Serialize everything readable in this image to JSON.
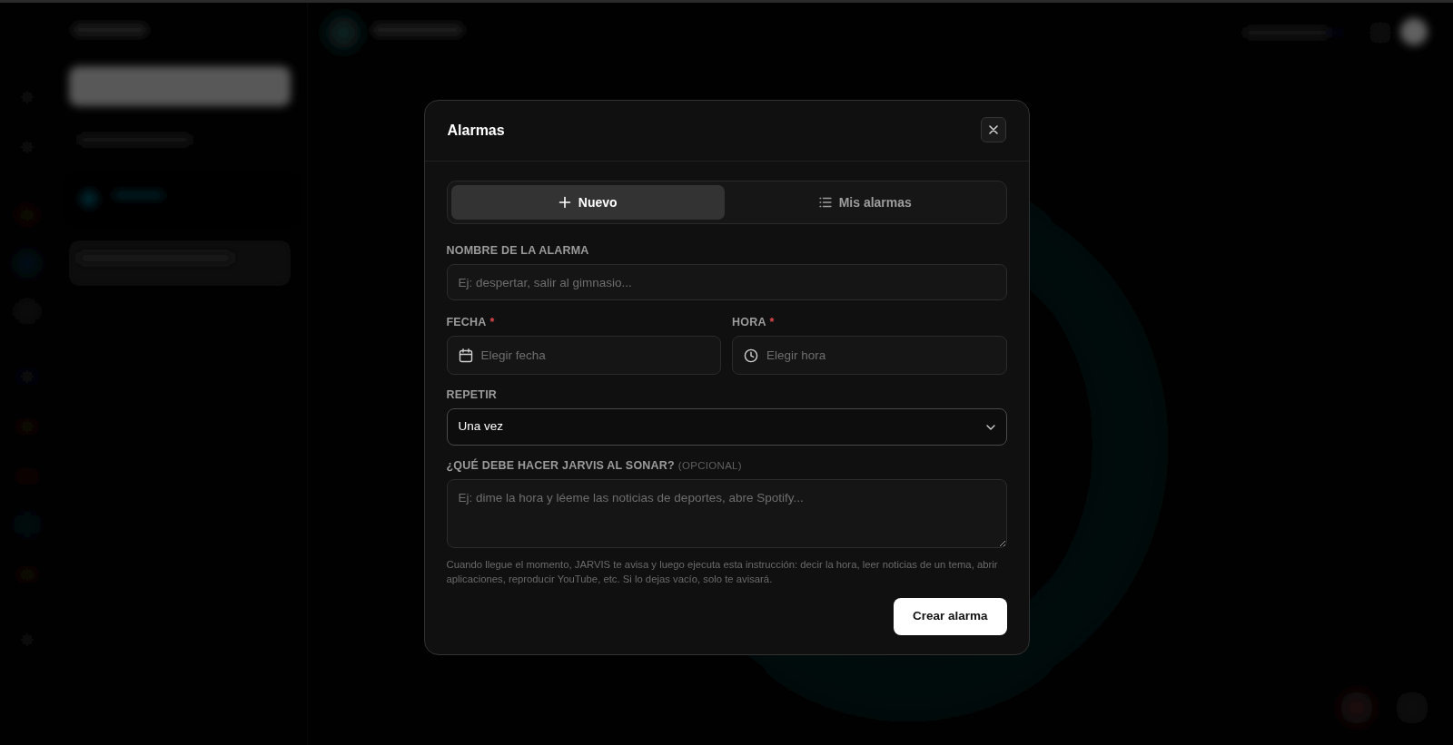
{
  "dialog": {
    "title": "Alarmas",
    "tabs": [
      {
        "kind": "new",
        "label": "Nuevo",
        "selected": true
      },
      {
        "kind": "list",
        "label": "Mis alarmas",
        "selected": false
      }
    ],
    "name_field": {
      "label": "NOMBRE DE LA ALARMA",
      "placeholder": "Ej: despertar, salir al gimnasio..."
    },
    "date_field": {
      "label": "FECHA",
      "required_mark": "*",
      "placeholder": "Elegir fecha"
    },
    "time_field": {
      "label": "HORA",
      "required_mark": "*",
      "placeholder": "Elegir hora"
    },
    "repeat_field": {
      "label": "REPETIR",
      "value": "Una vez"
    },
    "action_field": {
      "label": "¿QUÉ DEBE HACER JARVIS AL SONAR?",
      "optional_note": "(OPCIONAL)",
      "placeholder": "Ej: dime la hora y léeme las noticias de deportes, abre Spotify..."
    },
    "hint": "Cuando llegue el momento, JARVIS te avisa y luego ejecuta esta instrucción: decir la hora, leer noticias de un tema, abrir aplicaciones, reproducir YouTube, etc. Si lo dejas vacío, solo te avisará.",
    "submit_button": "Crear alarma"
  }
}
